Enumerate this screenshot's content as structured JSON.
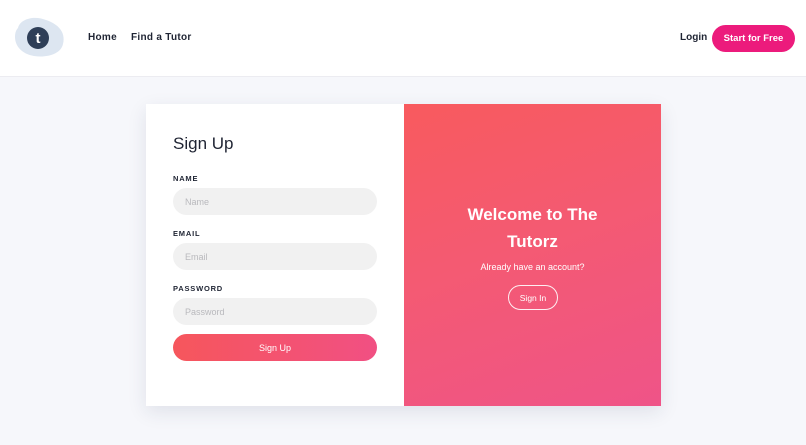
{
  "nav": {
    "logo_letter": "t",
    "logo_icon": "tutorz-logo-icon",
    "links": [
      "Home",
      "Find a Tutor"
    ],
    "login": "Login",
    "cta": "Start for Free",
    "cta_color": "#ec1b7c"
  },
  "signup": {
    "title": "Sign Up",
    "name_label": "NAME",
    "name_placeholder": "Name",
    "email_label": "EMAIL",
    "email_placeholder": "Email",
    "password_label": "PASSWORD",
    "password_placeholder": "Password",
    "submit": "Sign Up"
  },
  "welcome": {
    "title": "Welcome to The Tutorz",
    "subtitle": "Already have an account?",
    "signin": "Sign In",
    "gradient_start": "#f85a5e",
    "gradient_end": "#ef5488"
  }
}
